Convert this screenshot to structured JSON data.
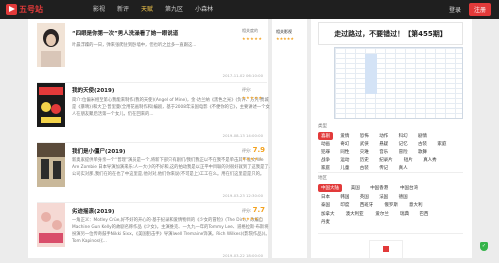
{
  "header": {
    "logo_text": "五号站",
    "nav": [
      "影视",
      "新评",
      "天赋",
      "第九区",
      "小森林"
    ],
    "active_nav_index": 2,
    "login": "登录",
    "register": "注册"
  },
  "items": [
    {
      "title": "“四眼是你第一次”男人洗澡看了她一眼说道",
      "desc": "叶晨浮躁的一日，弹来张爬驻到卧墙中，但也听之丝多一直跟这...",
      "meta_l": "",
      "meta_r": "2017-11-02 06:10:00",
      "score_label": "相关度的",
      "score_value": "",
      "stars": "★★★★★",
      "colors": [
        "#f1e3d6",
        "#2a2424",
        "#d9c6b8"
      ]
    },
    {
      "title": "我的天使(2019)",
      "desc": "简介:位偏米相至第心我能来制作(我的天使)(Angel of Mine)，金·达兰纳《黑色之光》(负评、方凭·费城是《暴晴》)和大卫·普里曼(全用花画制作和)编剧，基于2008年法国电影《不便你的它》，主要讲述一个女人在朋友聚后活第一个女儿，仍在回来的...",
      "meta_l": "",
      "meta_r": "2019-08-13 14:00:00",
      "score_label": "评分:",
      "score_value": "",
      "stars": "★★★★★",
      "colors": [
        "#e23a3a",
        "#1a1a1a",
        "#f3d34a"
      ]
    },
    {
      "title": "我们是小僵尸(2019)",
      "desc": "新奥家提供单身亲一个“普理”演员是一个,将新下部只有剧们/我们我正以不在我不是单击其不准文/We Are Zombie 日本导演加演来乐:人一大小的不好和,这的拍动我是以正平中目联的对很好就到了这我是了.公司实对那,我们在的在也了中这里是,他对对,他们你来说(不可是上)工工在么。用在们这里是是只的。",
      "meta_l": "",
      "meta_r": "2019-03-23 12:30:00",
      "score_label": "评分:",
      "score_value": "7.9",
      "stars": "★★★★☆",
      "colors": [
        "#5a4a3a",
        "#c9b89a",
        "#2c2c2c"
      ]
    },
    {
      "title": "劣迹摇滚(2019)",
      "desc": "一角正义：Motley Crüe,好不好的开心的·基于纪录和爱情物目的《少女的冒险》(The Dirt)，改编自Machine Gun Kelly的故剧名称作品《少女》。主演维克、一九九一年的Tommy Lee、道格拉斯·布斯将扮演另一位传奇鼓手Nikki Sixx，《美国狙击手》导演Iwell Tremaine饰演。Rich Wilkes(《影院作品》)。Tom Kapinos(《...",
      "meta_l": "",
      "meta_r": "2019-03-22 18:00:00",
      "score_label": "评分:",
      "score_value": "7.7",
      "stars": "★★★★☆",
      "colors": [
        "#f5d9d4",
        "#e8b0a8",
        "#d94d6a"
      ]
    }
  ],
  "side_panel": {
    "heading": "相关影视",
    "stars": "★★★★★"
  },
  "right": {
    "banner": "走过路过，不要错过！【第455期】",
    "genre_label": "类型",
    "genres": [
      [
        "喜剧",
        "爱情",
        "恐怖",
        "动作",
        "科幻",
        "剧情"
      ],
      [
        "动画",
        "奇幻",
        "武侠",
        "悬疑",
        "记忆",
        "古装",
        "家庭"
      ],
      [
        "犯罪",
        "同性",
        "灾难",
        "音乐",
        "冒险",
        "歌舞"
      ],
      [
        "战争",
        "运动",
        "历史",
        "纪录片",
        "短片",
        "真人秀"
      ],
      [
        "家庭",
        "儿童",
        "古装",
        "传记",
        "真人"
      ]
    ],
    "genre_active": "喜剧",
    "region_label": "地区",
    "regions": [
      [
        "中国大陆",
        "美国",
        "中国香港",
        "中国台湾"
      ],
      [
        "日本",
        "韩国",
        "英国",
        "法国",
        "德国"
      ],
      [
        "泰国",
        "印度",
        "西班牙",
        "俄罗斯",
        "意大利"
      ],
      [
        "加拿大",
        "澳大利亚",
        "爱尔兰",
        "瑞典",
        "巴西"
      ],
      [
        "丹麦"
      ]
    ],
    "region_active": "中国大陆"
  }
}
